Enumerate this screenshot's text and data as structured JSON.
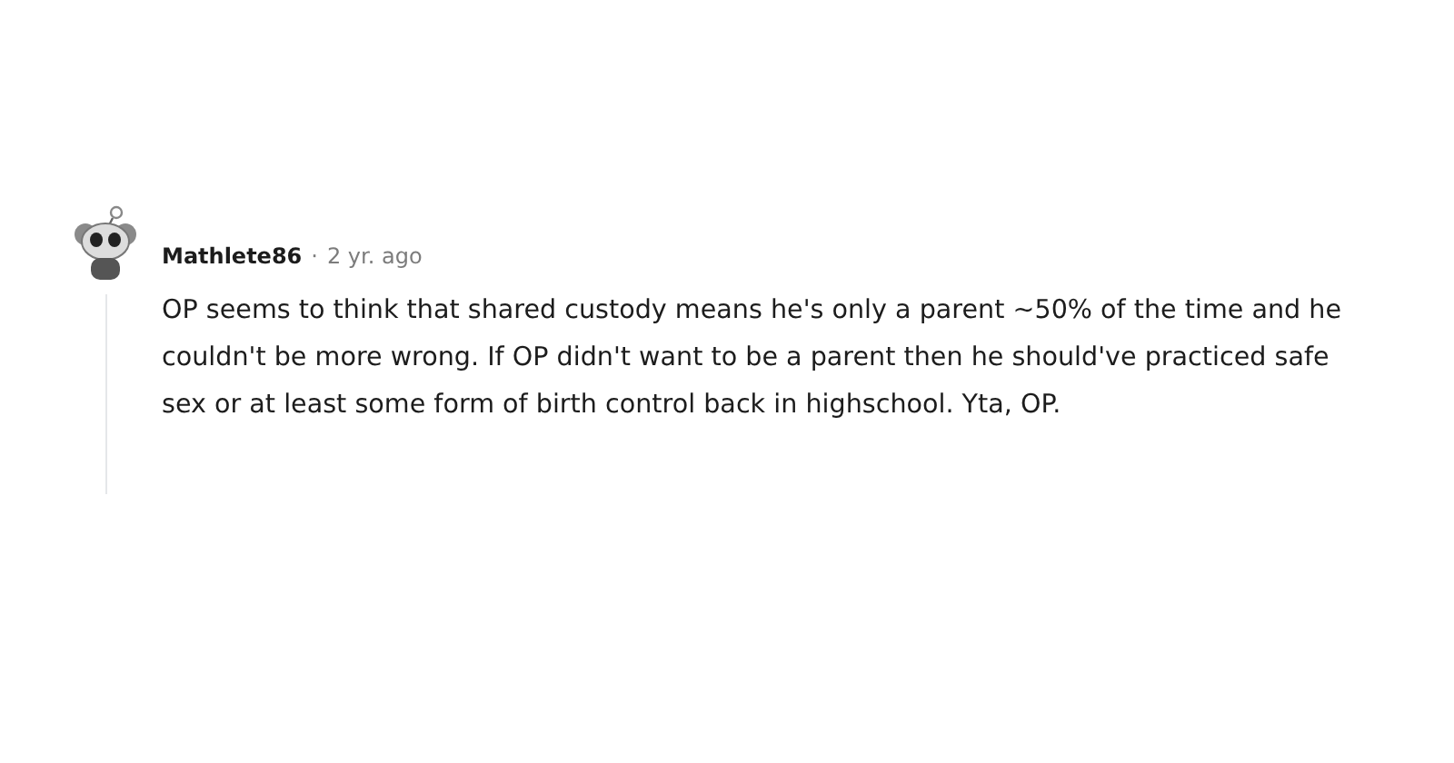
{
  "comment": {
    "author": "Mathlete86",
    "separator": "·",
    "time": "2 yr. ago",
    "body": "OP seems to think that shared custody means he's only a parent ~50% of the time and he couldn't be more wrong. If OP didn't want to be a parent then he should've practiced safe sex or at least some form of birth control back in highschool. Yta, OP."
  }
}
